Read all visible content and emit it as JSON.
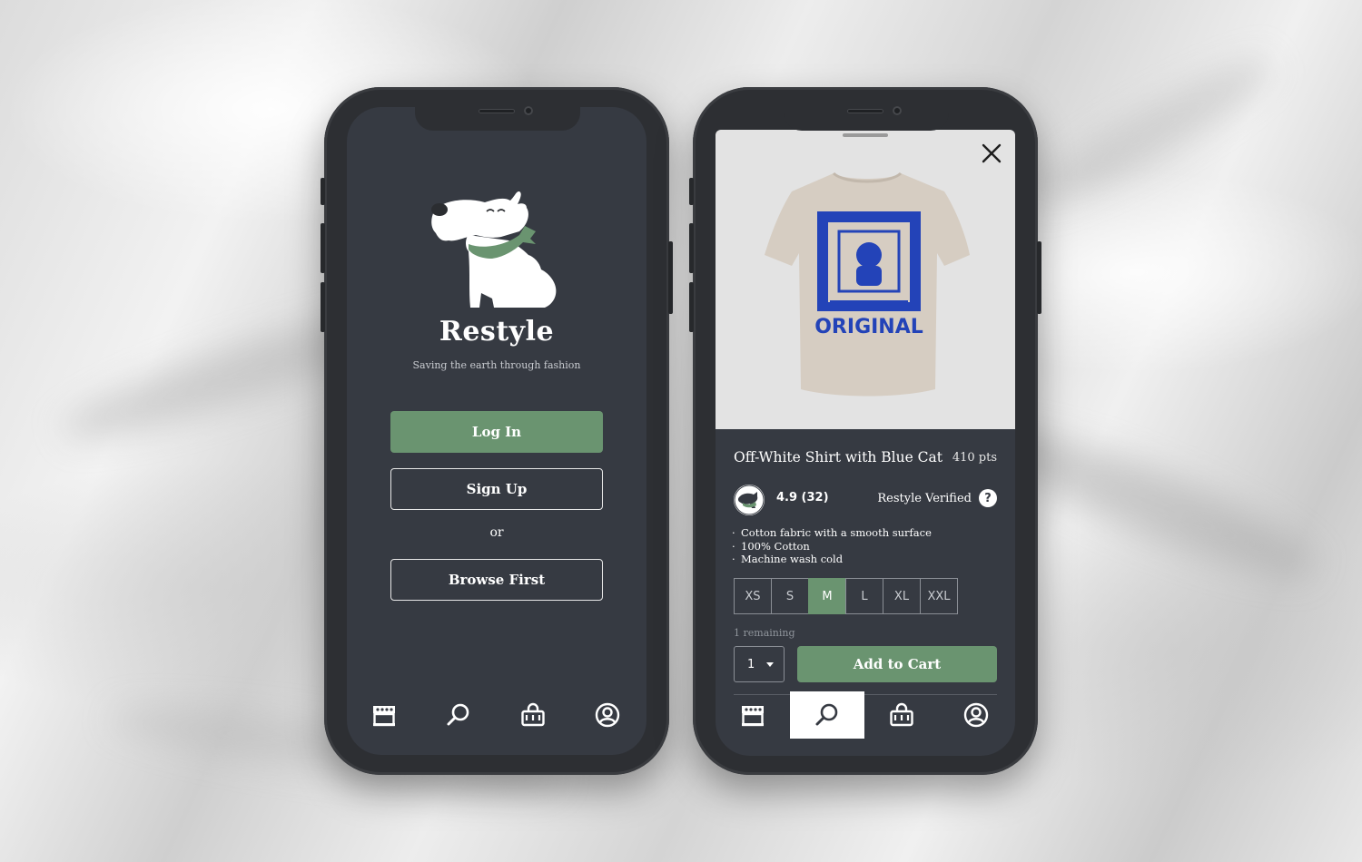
{
  "colors": {
    "screen_bg": "#363a42",
    "accent_green": "#6a9470",
    "frame": "#2d2f33"
  },
  "welcome": {
    "app_name": "Restyle",
    "tagline": "Saving the earth through fashion",
    "login_label": "Log In",
    "signup_label": "Sign Up",
    "or_label": "or",
    "browse_label": "Browse First"
  },
  "product": {
    "title": "Off-White Shirt with Blue Cat",
    "points": "410 pts",
    "rating": "4.9 (32)",
    "verified_label": "Restyle Verified",
    "help_label": "?",
    "details": [
      "Cotton fabric with a smooth surface",
      "100% Cotton",
      "Machine wash cold"
    ],
    "sizes": [
      "XS",
      "S",
      "M",
      "L",
      "XL",
      "XXL"
    ],
    "selected_size": "M",
    "remaining": "1 remaining",
    "quantity": "1",
    "add_to_cart_label": "Add to Cart",
    "shirt_print_text": "ORIGINAL"
  },
  "tabbar": {
    "icons": [
      "shop-icon",
      "search-icon",
      "bag-icon",
      "profile-icon"
    ],
    "active_left": "",
    "active_right": "search-icon"
  }
}
